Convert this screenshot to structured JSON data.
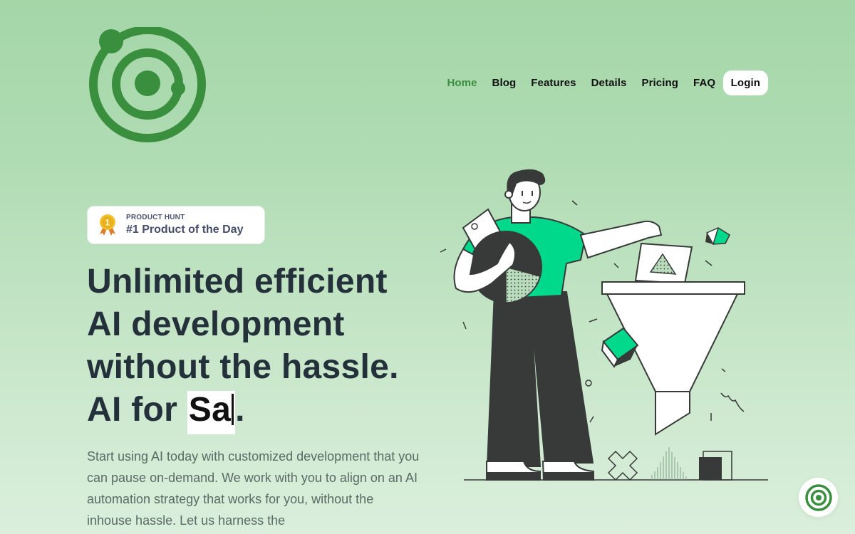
{
  "brand": {
    "logo_icon": "orbit-rings-icon",
    "accent_color": "#3a8f3e"
  },
  "nav": {
    "items": [
      {
        "label": "Home",
        "active": true
      },
      {
        "label": "Blog",
        "active": false
      },
      {
        "label": "Features",
        "active": false
      },
      {
        "label": "Details",
        "active": false
      },
      {
        "label": "Pricing",
        "active": false
      },
      {
        "label": "FAQ",
        "active": false
      }
    ],
    "login_label": "Login"
  },
  "badge": {
    "icon": "medal-icon",
    "medal_number": "1",
    "kicker": "PRODUCT HUNT",
    "title": "#1 Product of the Day"
  },
  "hero": {
    "headline_lines": [
      "Unlimited efficient",
      "AI development",
      "without the hassle."
    ],
    "typed_prefix": "AI for ",
    "typed_word": "Sa",
    "typed_suffix": ".",
    "description": "Start using AI today with customized development that you can pause on-demand. We work with you to align on an AI automation strategy that works for you, without the inhouse hassle. Let us harness the"
  },
  "illustration": {
    "name": "person-with-funnel-illustration",
    "primary_color": "#00d98b",
    "dark_color": "#373a38"
  },
  "chat_widget": {
    "icon": "orbit-rings-icon"
  }
}
